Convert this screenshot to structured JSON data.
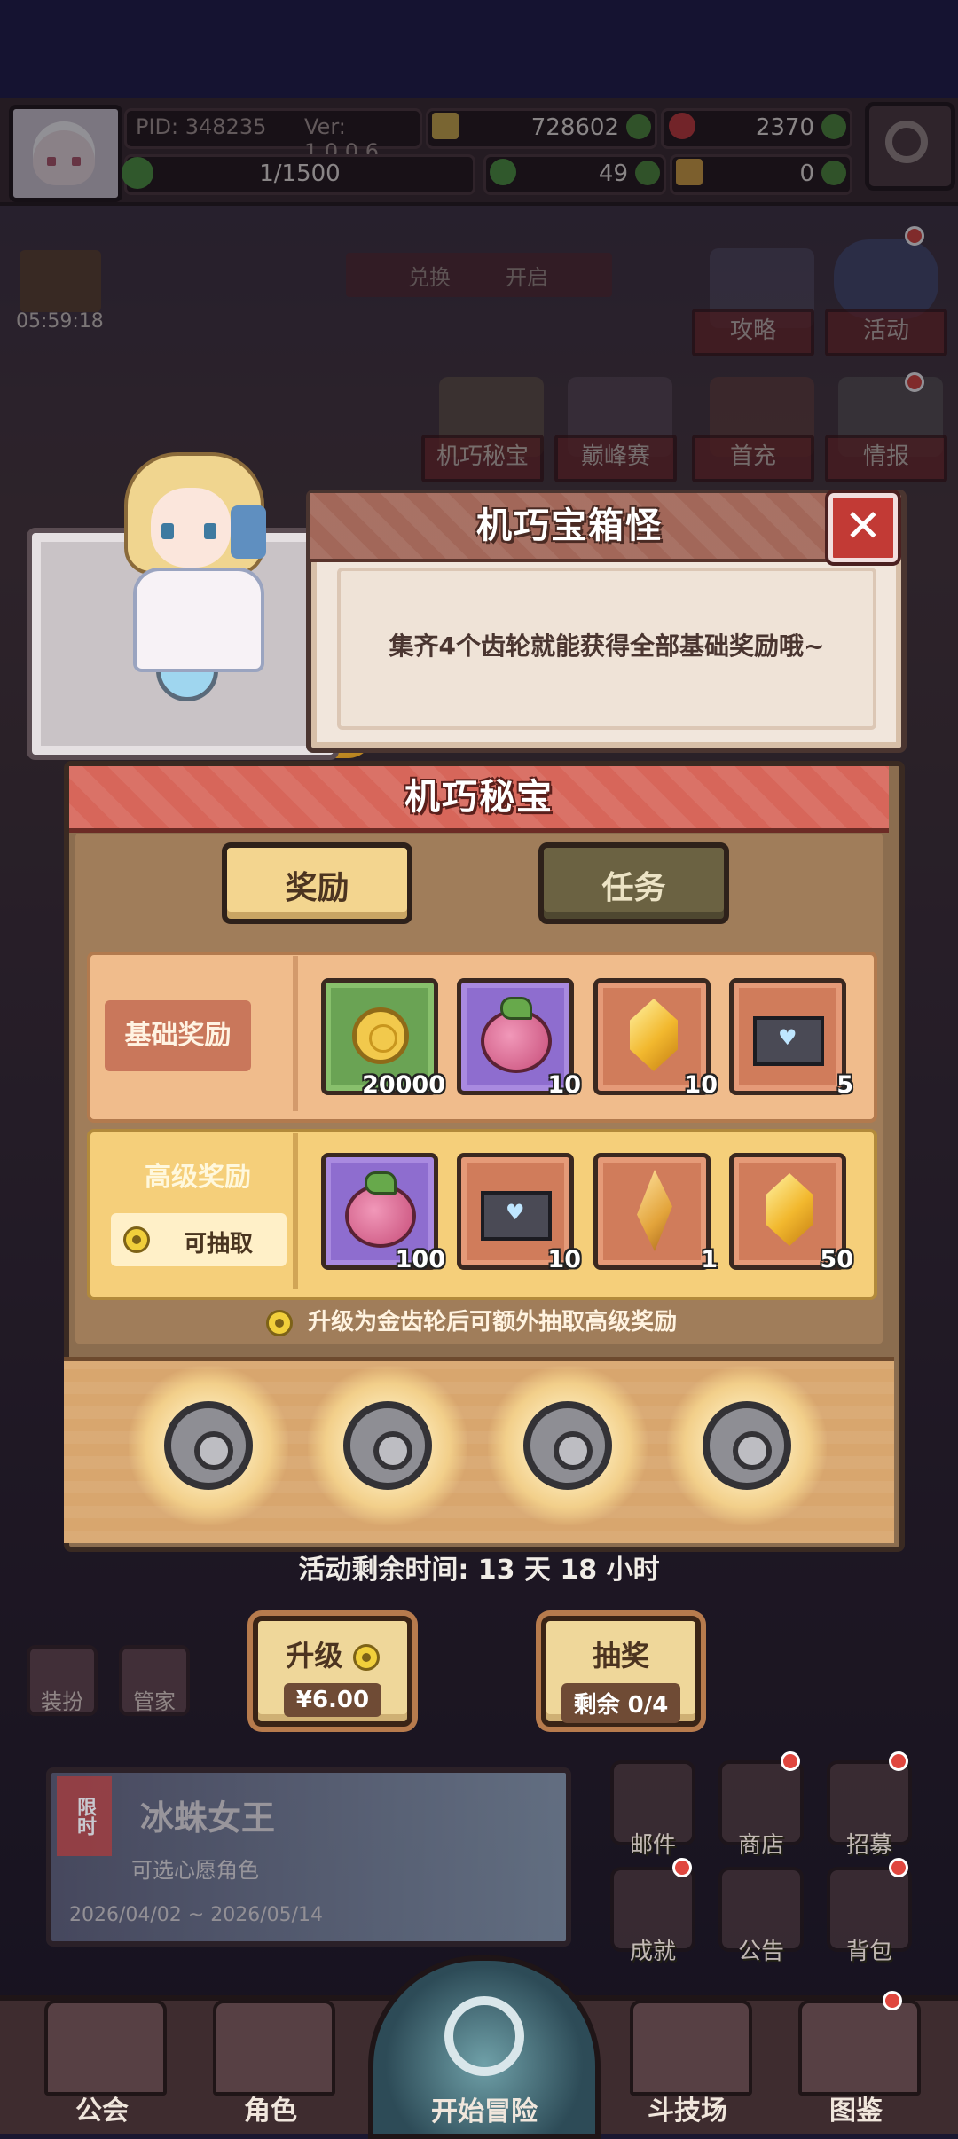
{
  "hud": {
    "pid": "PID: 348235",
    "version": "Ver: 1.0.0.6",
    "gold": "728602",
    "gems": "2370",
    "energy": "1/1500",
    "clover": "49",
    "tickets": "0",
    "timer": "05:59:18",
    "top_banner": "兑换",
    "top_banner2": "开启"
  },
  "top_icons": [
    "攻略",
    "活动",
    "机巧秘宝",
    "巅峰赛",
    "首充",
    "情报"
  ],
  "dialog": {
    "title": "机巧宝箱怪",
    "message": "集齐4个齿轮就能获得全部基础奖励哦~",
    "close": "✕"
  },
  "panel": {
    "title": "机巧秘宝",
    "tabs": {
      "reward": "奖励",
      "task": "任务"
    },
    "basic": {
      "label": "基础奖励",
      "items": [
        {
          "icon": "gold-coin-icon",
          "qty": "20000",
          "bg": "green"
        },
        {
          "icon": "berry-icon",
          "qty": "10",
          "bg": "purple"
        },
        {
          "icon": "crystal-icon",
          "qty": "10",
          "bg": "orange"
        },
        {
          "icon": "letter-icon",
          "qty": "5",
          "bg": "orange"
        }
      ]
    },
    "advanced": {
      "label": "高级奖励",
      "draw_tag": "可抽取",
      "items": [
        {
          "icon": "berry-icon",
          "qty": "100",
          "bg": "purple"
        },
        {
          "icon": "letter-icon",
          "qty": "10",
          "bg": "orange"
        },
        {
          "icon": "shard-icon",
          "qty": "1",
          "bg": "orange"
        },
        {
          "icon": "crystal-icon",
          "qty": "50",
          "bg": "orange"
        }
      ]
    },
    "hint": "升级为金齿轮后可额外抽取高级奖励",
    "gears_collected": 0,
    "gears_total": 4
  },
  "activity": {
    "remaining_label": "活动剩余时间: 13 天 18 小时",
    "upgrade": {
      "label": "升级",
      "price": "¥6.00"
    },
    "lottery": {
      "label": "抽奖",
      "remaining": "剩余 0/4"
    }
  },
  "side": {
    "dress": "装扮",
    "butler": "管家"
  },
  "banner": {
    "tag": "限时",
    "title": "冰蛛女王",
    "subtitle": "可选心愿角色",
    "dates": "2026/04/02 ~ 2026/05/14"
  },
  "menu": [
    "邮件",
    "商店",
    "招募",
    "成就",
    "公告",
    "背包"
  ],
  "nav": [
    "公会",
    "角色",
    "开始冒险",
    "斗技场",
    "图鉴"
  ]
}
